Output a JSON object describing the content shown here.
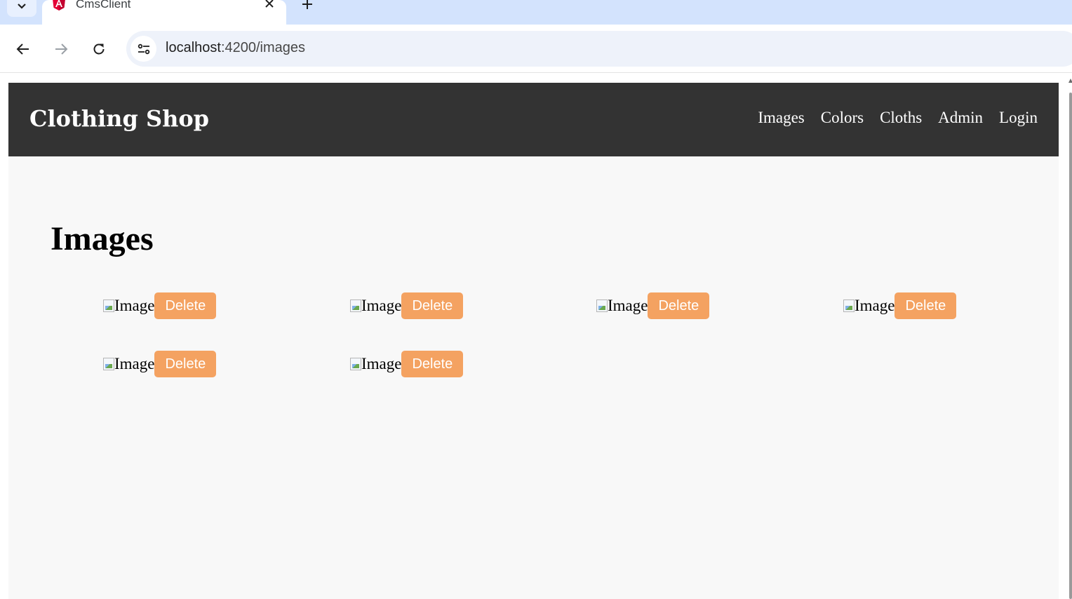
{
  "browser": {
    "tab_title": "CmsClient",
    "url_host": "localhost",
    "url_path": ":4200/images"
  },
  "navbar": {
    "brand": "Clothing Shop",
    "links": [
      {
        "label": "Images"
      },
      {
        "label": "Colors"
      },
      {
        "label": "Cloths"
      },
      {
        "label": "Admin"
      },
      {
        "label": "Login"
      }
    ]
  },
  "main": {
    "title": "Images",
    "items": [
      {
        "alt": "Image",
        "delete_label": "Delete"
      },
      {
        "alt": "Image",
        "delete_label": "Delete"
      },
      {
        "alt": "Image",
        "delete_label": "Delete"
      },
      {
        "alt": "Image",
        "delete_label": "Delete"
      },
      {
        "alt": "Image",
        "delete_label": "Delete"
      },
      {
        "alt": "Image",
        "delete_label": "Delete"
      }
    ]
  },
  "colors": {
    "navbar_bg": "#333333",
    "page_bg": "#f8f8f8",
    "delete_button": "#f4a261",
    "tabstrip": "#d3e3fd"
  },
  "icons": [
    "chevron-down-icon",
    "angular-logo-icon",
    "close-icon",
    "plus-icon",
    "back-arrow-icon",
    "forward-arrow-icon",
    "reload-icon",
    "site-info-icon",
    "broken-image-icon"
  ]
}
